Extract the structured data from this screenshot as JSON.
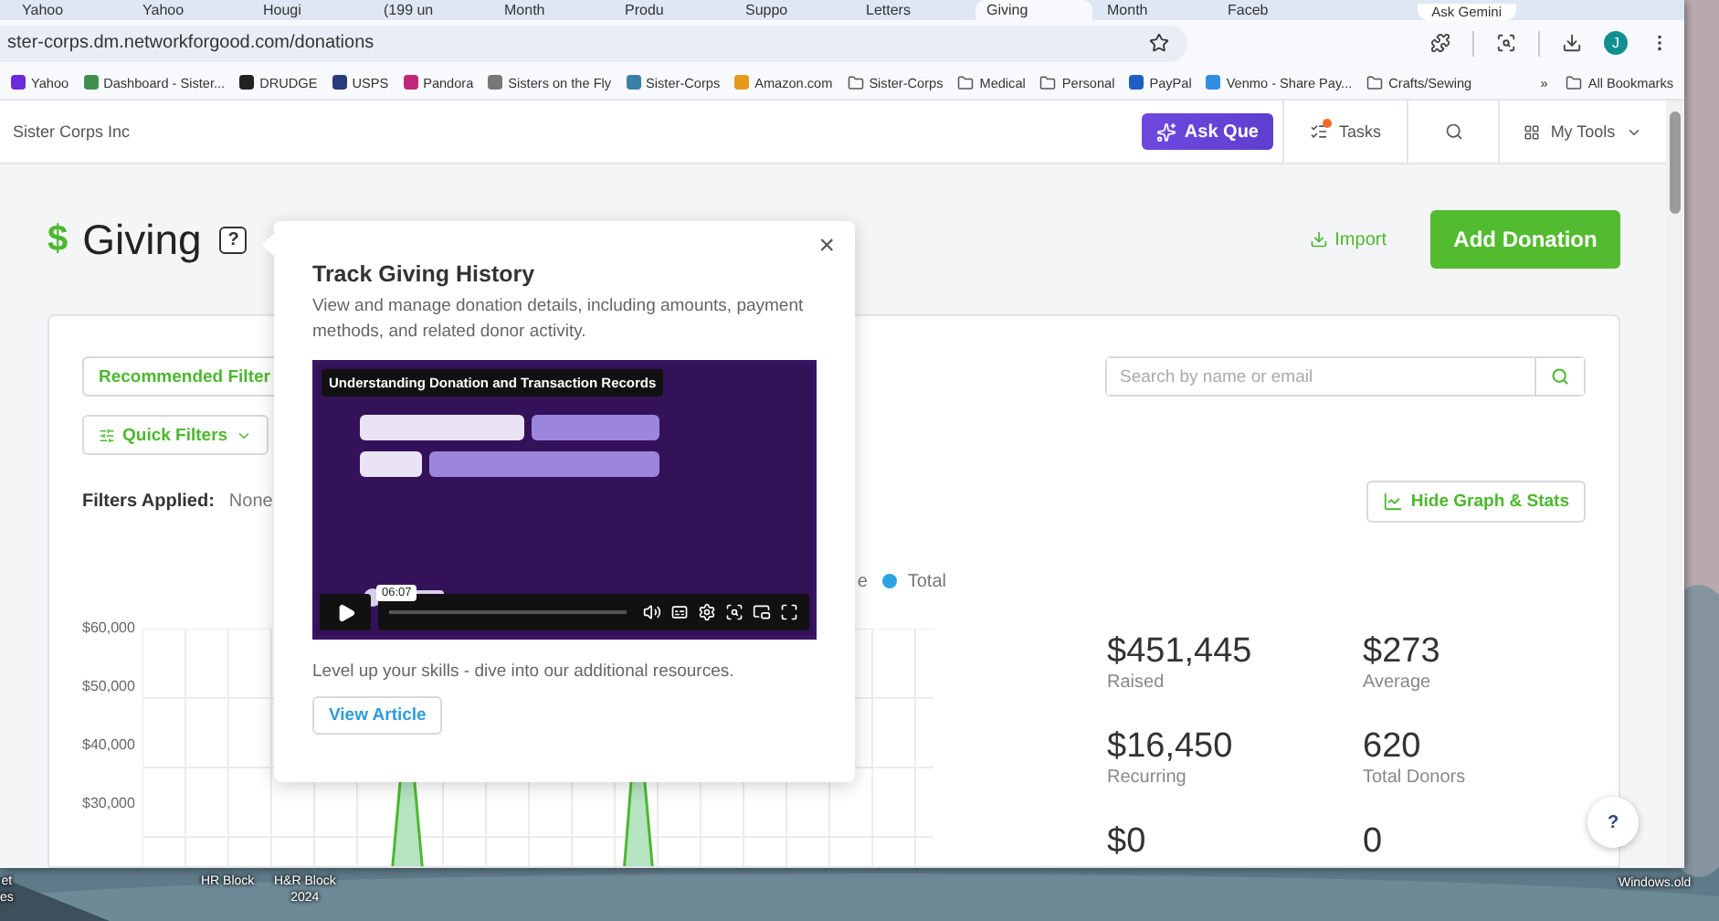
{
  "browser": {
    "tabs": [
      {
        "label": "Yahoo",
        "selected": false
      },
      {
        "label": "Yahoo",
        "selected": false
      },
      {
        "label": "Hougi",
        "selected": false
      },
      {
        "label": "(199 un",
        "selected": false
      },
      {
        "label": "Month",
        "selected": false
      },
      {
        "label": "Produ",
        "selected": false
      },
      {
        "label": "Suppo",
        "selected": false
      },
      {
        "label": "Letters",
        "selected": false
      },
      {
        "label": "Giving",
        "selected": true
      },
      {
        "label": "Month",
        "selected": false
      },
      {
        "label": "Faceb",
        "selected": false
      }
    ],
    "gemini_button": "Ask Gemini",
    "url": "ster-corps.dm.networkforgood.com/donations",
    "profile_initial": "J",
    "bookmarks": [
      {
        "label": "Yahoo",
        "kind": "site",
        "color": "#6b2bd9"
      },
      {
        "label": "Dashboard - Sister...",
        "kind": "site",
        "color": "#3f8f4f"
      },
      {
        "label": "DRUDGE",
        "kind": "site",
        "color": "#222222"
      },
      {
        "label": "USPS",
        "kind": "site",
        "color": "#2b3a78"
      },
      {
        "label": "Pandora",
        "kind": "site",
        "color": "#c0287a"
      },
      {
        "label": "Sisters on the Fly",
        "kind": "site",
        "color": "#777777"
      },
      {
        "label": "Sister-Corps",
        "kind": "site",
        "color": "#3a7fa8"
      },
      {
        "label": "Amazon.com",
        "kind": "site",
        "color": "#e59a1c"
      },
      {
        "label": "Sister-Corps",
        "kind": "folder"
      },
      {
        "label": "Medical",
        "kind": "folder"
      },
      {
        "label": "Personal",
        "kind": "folder"
      },
      {
        "label": "PayPal",
        "kind": "site",
        "color": "#1f5fc4"
      },
      {
        "label": "Venmo - Share Pay...",
        "kind": "site",
        "color": "#2f8de4"
      },
      {
        "label": "Crafts/Sewing",
        "kind": "folder"
      }
    ],
    "more_bookmarks": "»",
    "all_bookmarks": "All Bookmarks"
  },
  "app": {
    "org": "Sister Corps Inc",
    "ask_button": "Ask Que",
    "tasks": {
      "label": "Tasks",
      "alert": true
    },
    "tools_menu": "My Tools"
  },
  "page": {
    "currency_symbol": "$",
    "title": "Giving",
    "help": "?",
    "import": "Import",
    "add_button": "Add Donation"
  },
  "filters": {
    "recommended": "Recommended Filter",
    "quick": "Quick Filters",
    "applied_label": "Filters Applied:",
    "applied_value": "None",
    "search": {
      "placeholder": "Search by name or email"
    },
    "graph_toggle": "Hide Graph & Stats"
  },
  "chart": {
    "legend": [
      {
        "label": "e"
      },
      {
        "label": "Total",
        "color": "#2ea3e3"
      }
    ],
    "y_labels": [
      "$60,000",
      "$50,000",
      "$40,000",
      "$30,000"
    ]
  },
  "stats": [
    {
      "value": "$451,445",
      "label": "Raised"
    },
    {
      "value": "$273",
      "label": "Average"
    },
    {
      "value": "$16,450",
      "label": "Recurring"
    },
    {
      "value": "620",
      "label": "Total Donors"
    },
    {
      "value": "$0"
    },
    {
      "value": "0"
    }
  ],
  "popup": {
    "title": "Track Giving History",
    "description": "View and manage donation details, including amounts, payment methods, and related donor activity.",
    "video": {
      "title": "Understanding Donation and Transaction Records",
      "time": "06:07"
    },
    "footer": "Level up your skills - dive into our additional resources.",
    "button": "View Article",
    "close": "×"
  },
  "help_button": "?",
  "desktop": {
    "icons": [
      {
        "lines": [
          "et",
          "es"
        ]
      },
      {
        "lines": [
          "HR Block"
        ]
      },
      {
        "lines": [
          "H&R Block",
          "2024"
        ]
      },
      {
        "lines": [
          "Windows.old"
        ]
      }
    ]
  }
}
